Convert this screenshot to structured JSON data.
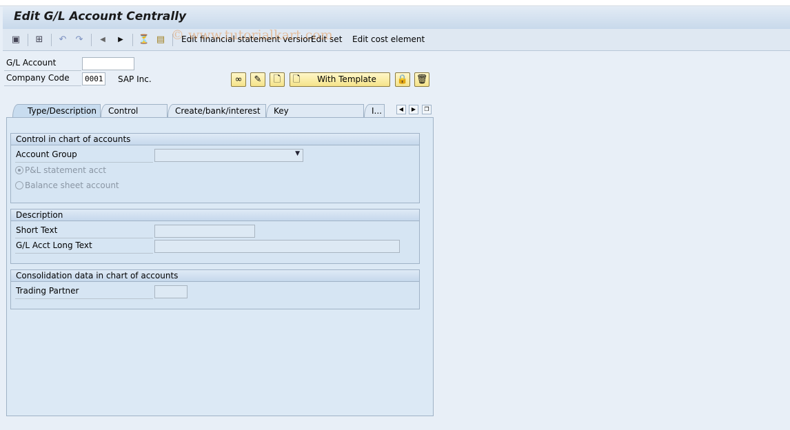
{
  "window": {
    "title": "Edit G/L Account Centrally"
  },
  "watermark": "© www.tutorialkart.com",
  "toolbar": {
    "items": [
      {
        "icon": "other-object-icon"
      },
      {
        "icon": "hierarchy-icon"
      },
      {
        "icon": "undo-icon"
      },
      {
        "icon": "redo-icon"
      },
      {
        "icon": "previous-icon"
      },
      {
        "icon": "next-icon"
      },
      {
        "icon": "filter-icon"
      },
      {
        "icon": "document-icon"
      }
    ],
    "edit_fs_version": "Edit financial statement version",
    "edit_set": "Edit set",
    "edit_cost_element": "Edit cost element"
  },
  "header": {
    "gl_account_label": "G/L Account",
    "gl_account_value": "",
    "company_code_label": "Company Code",
    "company_code_value": "0001",
    "company_name": "SAP Inc."
  },
  "actions": {
    "with_template": "With Template"
  },
  "tabs": [
    {
      "label": "Type/Description",
      "active": true
    },
    {
      "label": "Control Data"
    },
    {
      "label": "Create/bank/interest"
    },
    {
      "label": "Key word/translation"
    },
    {
      "label": "I..."
    }
  ],
  "control": {
    "title": "Control in chart of accounts",
    "account_group_label": "Account Group",
    "account_group_value": "",
    "pl_label": "P&L statement acct",
    "bs_label": "Balance sheet account",
    "selected": "pl"
  },
  "description": {
    "title": "Description",
    "short_text_label": "Short Text",
    "long_text_label": "G/L Acct Long Text"
  },
  "consolidation": {
    "title": "Consolidation data in chart of accounts",
    "trading_partner_label": "Trading Partner"
  }
}
